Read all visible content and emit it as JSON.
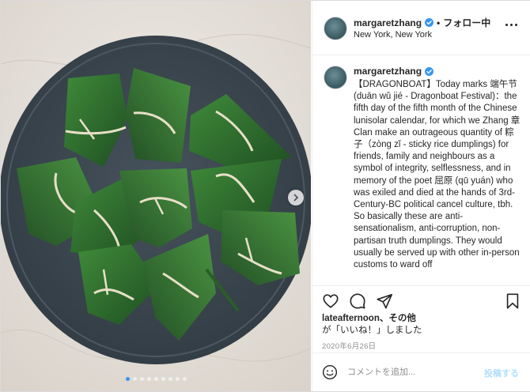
{
  "header": {
    "username": "margaretzhang",
    "separator": "•",
    "follow_label": "フォロー中",
    "location": "New York, New York"
  },
  "caption": {
    "username": "margaretzhang",
    "text": "【DRAGONBOAT】Today marks 端午节 (duān wǔ jié - Dragonboat Festival)：the fifth day of the fifth month of the Chinese lunisolar calendar, for which we Zhang 章 Clan make an outrageous quantity of 粽子（zòng zǐ - sticky rice dumplings) for friends, family and neighbours as a symbol of integrity, selflessness, and in memory of the poet 屈原 (qū yuán) who was exiled and died at the hands of 3rd-Century-BC political cancel culture, tbh. So basically these are anti-sensationalism, anti-corruption, non-partisan truth dumplings. They would usually be served up with other in-person customs to ward off"
  },
  "likes": {
    "names": "lateafternoon、その他",
    "suffix": "が「いいね！」しました"
  },
  "date": "2020年6月26日",
  "comment": {
    "placeholder": "コメントを追加...",
    "post_label": "投稿する"
  },
  "carousel": {
    "total": 9,
    "active": 1
  },
  "icons": {
    "verified": "verified-badge-icon",
    "more": "more-options-icon",
    "like": "heart-icon",
    "comment": "comment-icon",
    "share": "paper-plane-icon",
    "save": "bookmark-icon",
    "emoji": "smiley-icon",
    "next": "chevron-right-icon"
  },
  "colors": {
    "verified_blue": "#3897f0",
    "post_button": "#b2dffc",
    "plate": "#3c4750",
    "leaf": "#2f6b2f"
  }
}
